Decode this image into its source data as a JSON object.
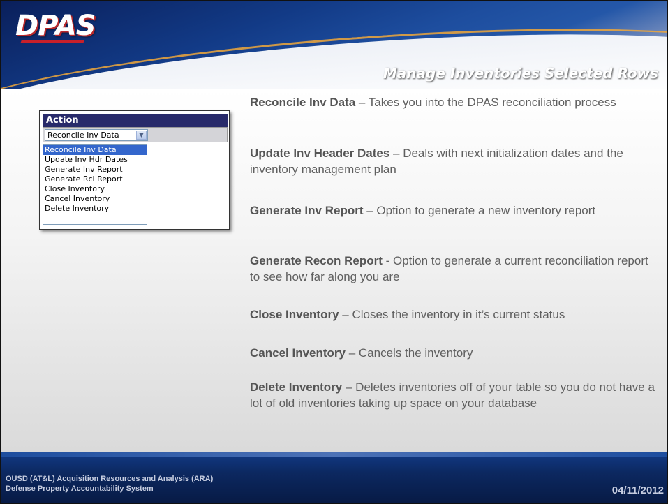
{
  "header": {
    "logo": "DPAS",
    "title": "Manage Inventories Selected Rows"
  },
  "action_dropdown": {
    "header": "Action",
    "selected_value": "Reconcile Inv Data",
    "options": [
      "Reconcile Inv Data",
      "Update Inv Hdr Dates",
      "Generate Inv Report",
      "Generate Rcl Report",
      "Close Inventory",
      "Cancel Inventory",
      "Delete Inventory"
    ],
    "highlighted_index": 0
  },
  "descriptions": [
    {
      "term": "Reconcile Inv Data",
      "text": " – Takes you into the DPAS reconciliation process"
    },
    {
      "term": "Update Inv Header Dates",
      "text": " – Deals with next initialization dates and the inventory management plan"
    },
    {
      "term": "Generate Inv Report",
      "text": " – Option to generate a new inventory report"
    },
    {
      "term": "Generate Recon Report",
      "text": " -  Option to generate a current reconciliation report to see how far along you are"
    },
    {
      "term": "Close Inventory",
      "text": " – Closes the inventory in it’s current status"
    },
    {
      "term": "Cancel Inventory",
      "text": " – Cancels the inventory"
    },
    {
      "term": "Delete Inventory",
      "text": " – Deletes inventories off of your table so you do not have a lot of old inventories taking up space on your database"
    }
  ],
  "footer": {
    "org_line1": "OUSD (AT&L) Acquisition Resources and Analysis (ARA)",
    "org_line2": "Defense Property Accountability System",
    "date": "04/11/2012"
  },
  "colors": {
    "header_blue": "#123a86",
    "action_header": "#282a6a",
    "selected_option": "#3366cc"
  }
}
